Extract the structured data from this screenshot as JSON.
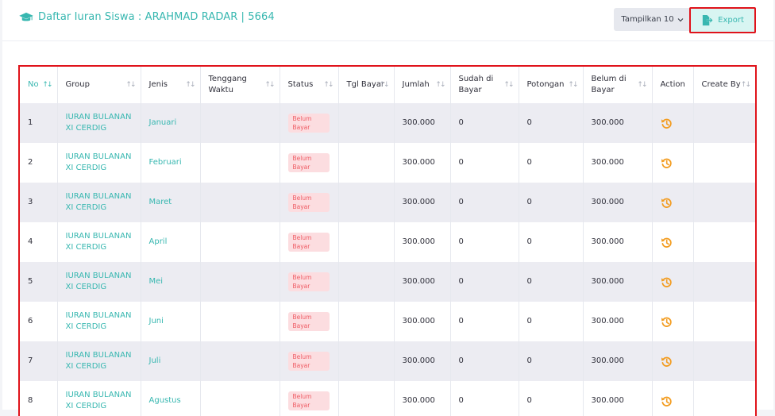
{
  "header": {
    "title": "Daftar Iuran Siswa : ARAHMAD RADAR | 5664",
    "show_label": "Tampilkan 10",
    "export_label": "Export"
  },
  "table": {
    "columns": [
      "No",
      "Group",
      "Jenis",
      "Tenggang Waktu",
      "Status",
      "Tgl Bayar",
      "Jumlah",
      "Sudah di Bayar",
      "Potongan",
      "Belum di Bayar",
      "Action",
      "Create By"
    ],
    "rows": [
      {
        "no": "1",
        "group": "IURAN BULANAN XI CERDIG",
        "jenis": "Januari",
        "tenggang": "",
        "status": "Belum Bayar",
        "tgl": "",
        "jumlah": "300.000",
        "sudah": "0",
        "potongan": "0",
        "belum": "300.000",
        "create_by": ""
      },
      {
        "no": "2",
        "group": "IURAN BULANAN XI CERDIG",
        "jenis": "Februari",
        "tenggang": "",
        "status": "Belum Bayar",
        "tgl": "",
        "jumlah": "300.000",
        "sudah": "0",
        "potongan": "0",
        "belum": "300.000",
        "create_by": ""
      },
      {
        "no": "3",
        "group": "IURAN BULANAN XI CERDIG",
        "jenis": "Maret",
        "tenggang": "",
        "status": "Belum Bayar",
        "tgl": "",
        "jumlah": "300.000",
        "sudah": "0",
        "potongan": "0",
        "belum": "300.000",
        "create_by": ""
      },
      {
        "no": "4",
        "group": "IURAN BULANAN XI CERDIG",
        "jenis": "April",
        "tenggang": "",
        "status": "Belum Bayar",
        "tgl": "",
        "jumlah": "300.000",
        "sudah": "0",
        "potongan": "0",
        "belum": "300.000",
        "create_by": ""
      },
      {
        "no": "5",
        "group": "IURAN BULANAN XI CERDIG",
        "jenis": "Mei",
        "tenggang": "",
        "status": "Belum Bayar",
        "tgl": "",
        "jumlah": "300.000",
        "sudah": "0",
        "potongan": "0",
        "belum": "300.000",
        "create_by": ""
      },
      {
        "no": "6",
        "group": "IURAN BULANAN XI CERDIG",
        "jenis": "Juni",
        "tenggang": "",
        "status": "Belum Bayar",
        "tgl": "",
        "jumlah": "300.000",
        "sudah": "0",
        "potongan": "0",
        "belum": "300.000",
        "create_by": ""
      },
      {
        "no": "7",
        "group": "IURAN BULANAN XI CERDIG",
        "jenis": "Juli",
        "tenggang": "",
        "status": "Belum Bayar",
        "tgl": "",
        "jumlah": "300.000",
        "sudah": "0",
        "potongan": "0",
        "belum": "300.000",
        "create_by": ""
      },
      {
        "no": "8",
        "group": "IURAN BULANAN XI CERDIG",
        "jenis": "Agustus",
        "tenggang": "",
        "status": "Belum Bayar",
        "tgl": "",
        "jumlah": "300.000",
        "sudah": "0",
        "potongan": "0",
        "belum": "300.000",
        "create_by": ""
      }
    ]
  },
  "icons": {
    "title": "graduation-cap-icon",
    "dropdown": "chevron-down-icon",
    "export": "file-export-icon",
    "sort": "sort-arrows-icon",
    "action": "history-icon"
  },
  "colors": {
    "accent": "#37b7b0",
    "status_bg": "#fcdde0",
    "status_text": "#ef5b63",
    "action_icon": "#f39c1f",
    "highlight_border": "#e0131b"
  }
}
